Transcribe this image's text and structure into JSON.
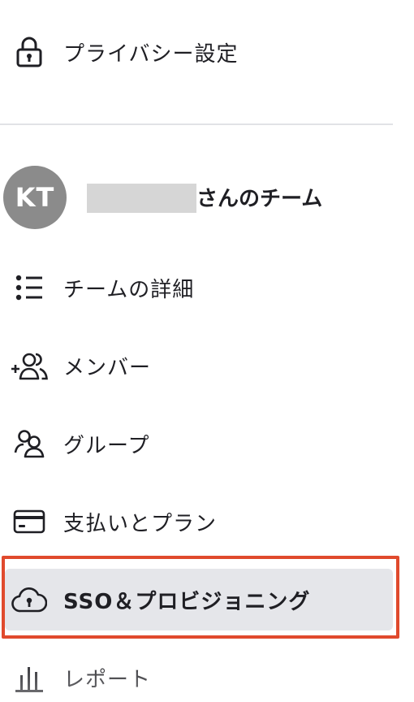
{
  "menu": {
    "privacy": {
      "label": "プライバシー設定",
      "icon": "lock-icon"
    },
    "team": {
      "avatar_initials": "KT",
      "name_suffix": "さんのチーム"
    },
    "items": [
      {
        "label": "チームの詳細",
        "icon": "list-icon"
      },
      {
        "label": "メンバー",
        "icon": "add-people-icon"
      },
      {
        "label": "グループ",
        "icon": "group-icon"
      },
      {
        "label": "支払いとプラン",
        "icon": "credit-card-icon"
      },
      {
        "label": "SSO＆プロビジョニング",
        "icon": "cloud-lock-icon",
        "selected": true
      },
      {
        "label": "レポート",
        "icon": "bar-chart-icon"
      }
    ]
  },
  "colors": {
    "highlight_border": "#e04a2d",
    "selected_bg": "#e5e6ea",
    "avatar_bg": "#8b8b8b"
  }
}
